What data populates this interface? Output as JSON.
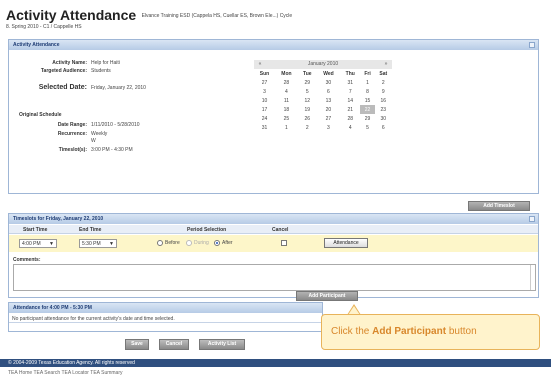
{
  "header": {
    "title": "Activity Attendance",
    "subtitle": "Elvance Training ESD (Cappela HS, Cuellar ES, Brown Ele...) Cycle",
    "term": "8. Spring 2010 - C1 / Cappelle HS"
  },
  "activity_panel": {
    "title": "Activity Attendance",
    "activity_name_label": "Activity Name:",
    "activity_name_value": "Help for Haiti",
    "audience_label": "Targeted Audience:",
    "audience_value": "Students",
    "selected_date_label": "Selected Date:",
    "selected_date_value": "Friday, January 22, 2010",
    "schedule_heading": "Original Schedule",
    "date_range_label": "Date Range:",
    "date_range_value": "1/11/2010 - 5/28/2010",
    "recurrence_label": "Recurrence:",
    "recurrence_value": "Weekly",
    "recurrence_day": "W",
    "timeslots_label": "Timeslot(s):",
    "timeslots_value": "3:00 PM - 4:30 PM"
  },
  "calendar": {
    "month_label": "January 2010",
    "prev": "«",
    "next": "»",
    "weekdays": [
      "Sun",
      "Mon",
      "Tue",
      "Wed",
      "Thu",
      "Fri",
      "Sat"
    ],
    "weeks": [
      [
        "27",
        "28",
        "29",
        "30",
        "31",
        "1",
        "2"
      ],
      [
        "3",
        "4",
        "5",
        "6",
        "7",
        "8",
        "9"
      ],
      [
        "10",
        "11",
        "12",
        "13",
        "14",
        "15",
        "16"
      ],
      [
        "17",
        "18",
        "19",
        "20",
        "21",
        "22",
        "23"
      ],
      [
        "24",
        "25",
        "26",
        "27",
        "28",
        "29",
        "30"
      ],
      [
        "31",
        "1",
        "2",
        "3",
        "4",
        "5",
        "6"
      ]
    ],
    "selected_day": "22"
  },
  "add_timeslot_label": "Add Timeslot",
  "timeslots_panel": {
    "title": "Timeslots for Friday, January 22, 2010",
    "col_start": "Start Time",
    "col_end": "End Time",
    "col_period": "Period Selection",
    "col_cancel": "Cancel",
    "start_value": "4:00 PM",
    "end_value": "5:30 PM",
    "before_label": "Before",
    "during_label": "During",
    "after_label": "After",
    "selected_period": "After",
    "attendance_button": "Attendance",
    "comments_label": "Comments:"
  },
  "add_participant_label": "Add Participant",
  "attendance_panel": {
    "title": "Attendance for 4:00 PM - 5:30 PM",
    "message": "No participant attendance for the current activity's date and time selected."
  },
  "buttons": {
    "save": "Save",
    "cancel": "Cancel",
    "activity_list": "Activity List"
  },
  "callout": {
    "prefix": "Click the",
    "bold": "Add Participant",
    "suffix": "button"
  },
  "footer": {
    "copyright": "© 2004-2009 Texas Education Agency. All rights reserved",
    "links": "TEA Home   TEA Search   TEA Locator   TEA Summary"
  }
}
